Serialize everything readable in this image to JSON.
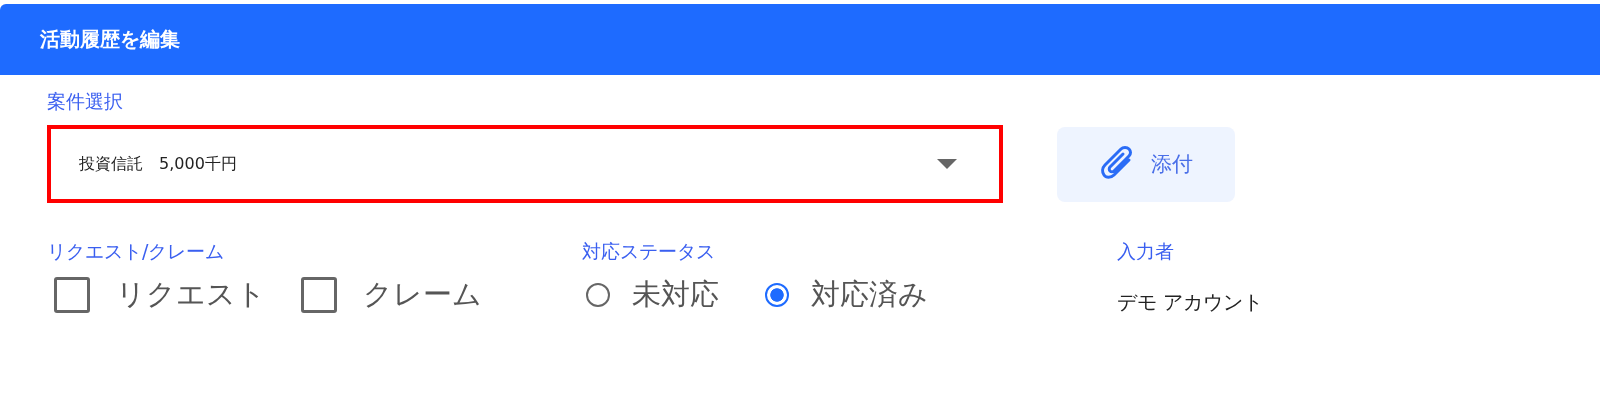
{
  "dialog": {
    "title": "活動履歴を編集"
  },
  "case_select": {
    "label": "案件選択",
    "value": "投資信託　5,000千円",
    "highlighted": true
  },
  "attach_button": {
    "label": "添付"
  },
  "request_claim": {
    "label": "リクエスト/クレーム",
    "options": [
      {
        "label": "リクエスト",
        "checked": false
      },
      {
        "label": "クレーム",
        "checked": false
      }
    ]
  },
  "status": {
    "label": "対応ステータス",
    "options": [
      {
        "label": "未対応",
        "selected": false
      },
      {
        "label": "対応済み",
        "selected": true
      }
    ]
  },
  "entered_by": {
    "label": "入力者",
    "value": "デモ アカウント"
  }
}
